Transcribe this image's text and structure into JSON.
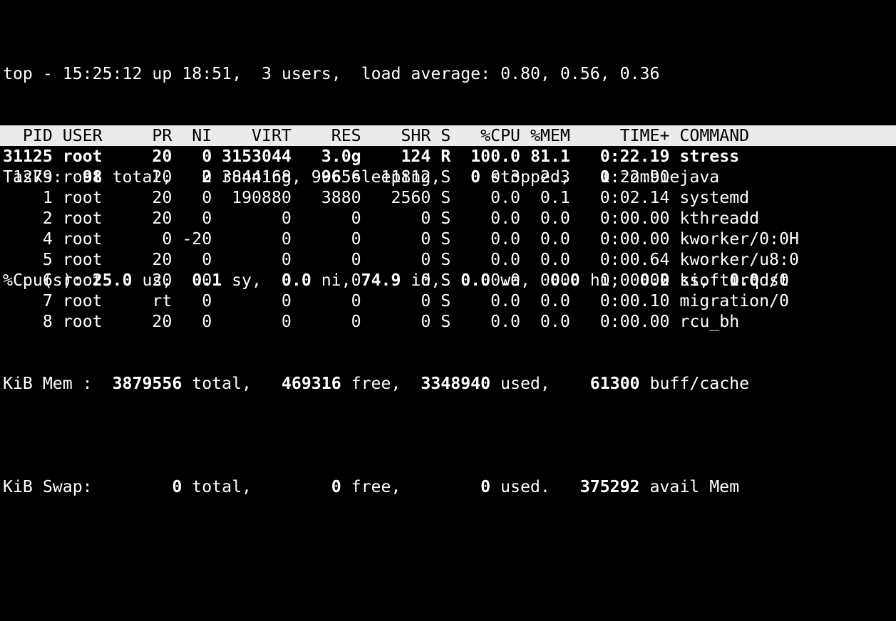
{
  "summary": {
    "line1": {
      "prefix": "top - ",
      "time": "15:25:12",
      "uptime_label": " up ",
      "uptime": "18:51",
      "sep1": ",  ",
      "users": "3",
      "users_label": " users,  load average: ",
      "load1": "0.80",
      "sep2": ", ",
      "load5": "0.56",
      "sep3": ", ",
      "load15": "0.36"
    },
    "tasks": {
      "label": "Tasks:  ",
      "total": "98",
      "total_label": " total,   ",
      "running": "2",
      "running_label": " running,  ",
      "sleeping": "96",
      "sleeping_label": " sleeping,   ",
      "stopped": "0",
      "stopped_label": " stopped,   ",
      "zombie": "0",
      "zombie_label": " zombie"
    },
    "cpu": {
      "label": "%Cpu(s): ",
      "us": "25.0",
      "us_label": " us,  ",
      "sy": "0.1",
      "sy_label": " sy,  ",
      "ni": "0.0",
      "ni_label": " ni, ",
      "id": "74.9",
      "id_label": " id,  ",
      "wa": "0.0",
      "wa_label": " wa,  ",
      "hi": "0.0",
      "hi_label": " hi,  ",
      "si": "0.0",
      "si_label": " si,  ",
      "st": "0.0",
      "st_label": " st"
    },
    "mem": {
      "label": "KiB Mem :  ",
      "total": "3879556",
      "total_label": " total,   ",
      "free": "469316",
      "free_label": " free,  ",
      "used": "3348940",
      "used_label": " used,    ",
      "buff": "61300",
      "buff_label": " buff/cache"
    },
    "swap": {
      "label": "KiB Swap:        ",
      "total": "0",
      "total_label": " total,        ",
      "free": "0",
      "free_label": " free,        ",
      "used": "0",
      "used_label": " used.   ",
      "avail": "375292",
      "avail_label": " avail Mem"
    }
  },
  "columns": [
    "PID",
    "USER",
    "PR",
    "NI",
    "VIRT",
    "RES",
    "SHR",
    "S",
    "%CPU",
    "%MEM",
    "TIME+",
    "COMMAND"
  ],
  "processes": [
    {
      "pid": "31125",
      "user": "root",
      "pr": "20",
      "ni": "0",
      "virt": "3153044",
      "res": "3.0g",
      "shr": "124",
      "s": "R",
      "cpu": "100.0",
      "mem": "81.1",
      "time": "0:22.19",
      "command": "stress",
      "bold": true
    },
    {
      "pid": "1279",
      "user": "root",
      "pr": "20",
      "ni": "0",
      "virt": "3844168",
      "res": "90656",
      "shr": "11812",
      "s": "S",
      "cpu": "0.3",
      "mem": "2.3",
      "time": "1:22.90",
      "command": "java",
      "bold": false
    },
    {
      "pid": "1",
      "user": "root",
      "pr": "20",
      "ni": "0",
      "virt": "190880",
      "res": "3880",
      "shr": "2560",
      "s": "S",
      "cpu": "0.0",
      "mem": "0.1",
      "time": "0:02.14",
      "command": "systemd",
      "bold": false
    },
    {
      "pid": "2",
      "user": "root",
      "pr": "20",
      "ni": "0",
      "virt": "0",
      "res": "0",
      "shr": "0",
      "s": "S",
      "cpu": "0.0",
      "mem": "0.0",
      "time": "0:00.00",
      "command": "kthreadd",
      "bold": false
    },
    {
      "pid": "4",
      "user": "root",
      "pr": "0",
      "ni": "-20",
      "virt": "0",
      "res": "0",
      "shr": "0",
      "s": "S",
      "cpu": "0.0",
      "mem": "0.0",
      "time": "0:00.00",
      "command": "kworker/0:0H",
      "bold": false
    },
    {
      "pid": "5",
      "user": "root",
      "pr": "20",
      "ni": "0",
      "virt": "0",
      "res": "0",
      "shr": "0",
      "s": "S",
      "cpu": "0.0",
      "mem": "0.0",
      "time": "0:00.64",
      "command": "kworker/u8:0",
      "bold": false
    },
    {
      "pid": "6",
      "user": "root",
      "pr": "20",
      "ni": "0",
      "virt": "0",
      "res": "0",
      "shr": "0",
      "s": "S",
      "cpu": "0.0",
      "mem": "0.0",
      "time": "0:00.02",
      "command": "ksoftirqd/0",
      "bold": false
    },
    {
      "pid": "7",
      "user": "root",
      "pr": "rt",
      "ni": "0",
      "virt": "0",
      "res": "0",
      "shr": "0",
      "s": "S",
      "cpu": "0.0",
      "mem": "0.0",
      "time": "0:00.10",
      "command": "migration/0",
      "bold": false
    },
    {
      "pid": "8",
      "user": "root",
      "pr": "20",
      "ni": "0",
      "virt": "0",
      "res": "0",
      "shr": "0",
      "s": "S",
      "cpu": "0.0",
      "mem": "0.0",
      "time": "0:00.00",
      "command": "rcu_bh",
      "bold": false
    }
  ]
}
